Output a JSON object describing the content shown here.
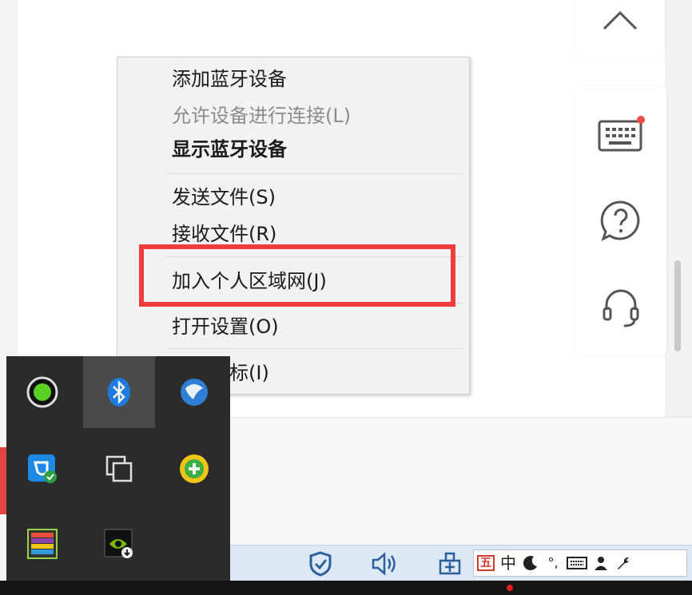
{
  "context_menu": {
    "items": [
      {
        "label": "添加蓝牙设备",
        "state": "normal"
      },
      {
        "label": "允许设备进行连接(L)",
        "state": "disabled"
      },
      {
        "label": "显示蓝牙设备",
        "state": "bold"
      },
      {
        "label": "发送文件(S)",
        "state": "normal"
      },
      {
        "label": "接收文件(R)",
        "state": "normal"
      },
      {
        "label": "加入个人区域网(J)",
        "state": "highlighted"
      },
      {
        "label": "打开设置(O)",
        "state": "normal"
      },
      {
        "label": "删除图标(I)",
        "state": "normal"
      }
    ],
    "highlight_color": "#f03c3c"
  },
  "side_tools": {
    "icons": [
      "chevron-up-icon",
      "keyboard-icon",
      "help-icon",
      "headset-icon"
    ],
    "notification_dot_color": "#f04a4a"
  },
  "tray_popup": {
    "icons": [
      "green-status-icon",
      "bluetooth-icon",
      "network-globe-icon",
      "security-shield-app-icon",
      "copy-windows-icon",
      "green-plus-app-icon",
      "color-grid-app-icon",
      "nvidia-icon"
    ]
  },
  "taskbar": {
    "icons": [
      "defender-shield-icon",
      "volume-icon",
      "network-icon"
    ],
    "ime": {
      "mode_label": "五",
      "lang_label": "中",
      "punct_label": "°,"
    }
  }
}
